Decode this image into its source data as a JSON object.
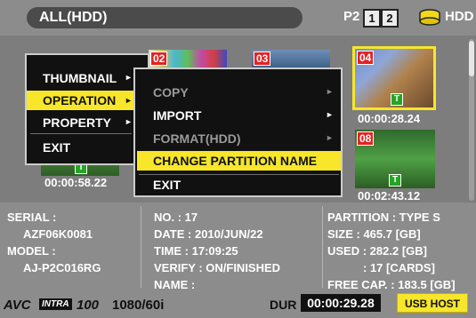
{
  "header": {
    "title": "ALL(HDD)",
    "p2_label": "P2",
    "slot1": "1",
    "slot2": "2",
    "hdd_label": "HDD"
  },
  "thumbnails": [
    {
      "num": "",
      "timecode": "00:00:58.22"
    },
    {
      "num": "02",
      "timecode": ""
    },
    {
      "num": "03",
      "timecode": ""
    },
    {
      "num": "04",
      "timecode": "00:00:28.24"
    },
    {
      "num": "08",
      "timecode": "00:02:43.12"
    }
  ],
  "t_badge": "T",
  "menu_main": {
    "items": [
      "THUMBNAIL",
      "OPERATION",
      "PROPERTY",
      "EXIT"
    ],
    "selected": "OPERATION"
  },
  "menu_operation": {
    "items": [
      "COPY",
      "IMPORT",
      "FORMAT(HDD)",
      "CHANGE PARTITION NAME",
      "EXIT"
    ],
    "disabled": [
      "COPY",
      "FORMAT(HDD)"
    ],
    "selected": "CHANGE PARTITION NAME"
  },
  "info": {
    "serial_label": "SERIAL :",
    "serial": "AZF06K0081",
    "model_label": "MODEL :",
    "model": "AJ-P2C016RG",
    "no": "NO. : 17",
    "date": "DATE : 2010/JUN/22",
    "time": "TIME : 17:09:25",
    "verify": "VERIFY : ON/FINISHED",
    "name": "NAME :",
    "partition": "PARTITION : TYPE S",
    "size": "SIZE : 465.7 [GB]",
    "used": "USED : 282.2 [GB]",
    "cards": ": 17 [CARDS]",
    "free": "FREE CAP. : 183.5 [GB]"
  },
  "footer": {
    "avc": "AVC",
    "intra": "INTRA",
    "bitrate": "100",
    "format": "1080/60i",
    "dur_label": "DUR",
    "dur": "00:00:29.28",
    "usb": "USB HOST"
  },
  "colors": {
    "selection": "#f7e62a",
    "clip_number": "#e52222",
    "t_badge": "#27a327"
  }
}
